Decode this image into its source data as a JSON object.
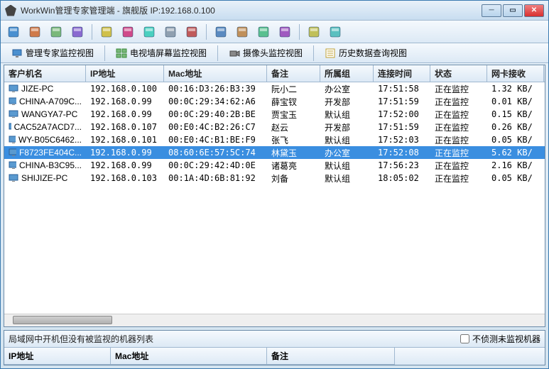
{
  "window": {
    "title": "WorkWin管理专家管理端 - 旗舰版 IP:192.168.0.100"
  },
  "tabs": [
    {
      "label": "管理专家监控视图"
    },
    {
      "label": "电视墙屏幕监控视图"
    },
    {
      "label": "摄像头监控视图"
    },
    {
      "label": "历史数据查询视图"
    }
  ],
  "columns": [
    "客户机名",
    "IP地址",
    "Mac地址",
    "备注",
    "所属组",
    "连接时间",
    "状态",
    "网卡接收"
  ],
  "rows": [
    {
      "name": "JIZE-PC",
      "ip": "192.168.0.100",
      "mac": "00:16:D3:26:B3:39",
      "note": "阮小二",
      "group": "办公室",
      "time": "17:51:58",
      "status": "正在监控",
      "net": "1.32 KB/",
      "sel": false
    },
    {
      "name": "CHINA-A709C...",
      "ip": "192.168.0.99",
      "mac": "00:0C:29:34:62:A6",
      "note": "薛宝钗",
      "group": "开发部",
      "time": "17:51:59",
      "status": "正在监控",
      "net": "0.01 KB/",
      "sel": false
    },
    {
      "name": "WANGYA7-PC",
      "ip": "192.168.0.99",
      "mac": "00:0C:29:40:2B:BE",
      "note": "贾宝玉",
      "group": "默认组",
      "time": "17:52:00",
      "status": "正在监控",
      "net": "0.15 KB/",
      "sel": false
    },
    {
      "name": "CAC52A7ACD7...",
      "ip": "192.168.0.107",
      "mac": "00:E0:4C:B2:26:C7",
      "note": "赵云",
      "group": "开发部",
      "time": "17:51:59",
      "status": "正在监控",
      "net": "0.26 KB/",
      "sel": false
    },
    {
      "name": "WY-B05C6462...",
      "ip": "192.168.0.101",
      "mac": "00:E0:4C:B1:BE:F9",
      "note": "张飞",
      "group": "默认组",
      "time": "17:52:03",
      "status": "正在监控",
      "net": "0.05 KB/",
      "sel": false
    },
    {
      "name": "F8723FE404C...",
      "ip": "192.168.0.99",
      "mac": "08:60:6E:57:5C:74",
      "note": "林黛玉",
      "group": "办公室",
      "time": "17:52:08",
      "status": "正在监控",
      "net": "5.62 KB/",
      "sel": true
    },
    {
      "name": "CHINA-B3C95...",
      "ip": "192.168.0.99",
      "mac": "00:0C:29:42:4D:0E",
      "note": "诸葛亮",
      "group": "默认组",
      "time": "17:56:23",
      "status": "正在监控",
      "net": "2.16 KB/",
      "sel": false
    },
    {
      "name": "SHIJIZE-PC",
      "ip": "192.168.0.103",
      "mac": "00:1A:4D:6B:81:92",
      "note": "刘备",
      "group": "默认组",
      "time": "18:05:02",
      "status": "正在监控",
      "net": "0.05 KB/",
      "sel": false
    }
  ],
  "bottom": {
    "label": "局域网中开机但没有被监视的机器列表",
    "checkbox": "不侦测未监视机器",
    "columns": [
      "IP地址",
      "Mac地址",
      "备注"
    ]
  },
  "toolbar_icons": [
    "tool-1",
    "tool-2",
    "tool-3",
    "tool-4",
    "tool-5",
    "tool-6",
    "tool-7",
    "tool-8",
    "tool-9",
    "tool-10",
    "tool-11",
    "tool-12",
    "tool-13",
    "tool-14",
    "tool-15"
  ]
}
